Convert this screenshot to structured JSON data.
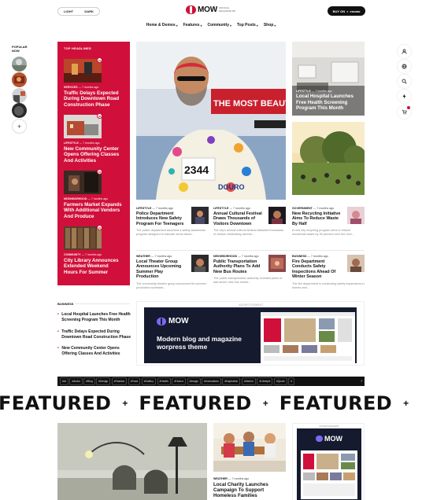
{
  "theme_toggle": {
    "light": "LIGHT",
    "dark": "DARK"
  },
  "brand": {
    "name": "MOW",
    "tagline": "OFFICIAL MAGAZINE WP"
  },
  "buy_button": {
    "prefix": "BUY ON",
    "market": "envato"
  },
  "nav": [
    {
      "label": "Home & Demos"
    },
    {
      "label": "Features"
    },
    {
      "label": "Community"
    },
    {
      "label": "Top Posts"
    },
    {
      "label": "Shop"
    }
  ],
  "popular": {
    "label": "POPULAR NOW",
    "add": "+"
  },
  "right_rail": [
    "user-icon",
    "globe-icon",
    "search-icon",
    "bolt-icon",
    "cart-icon"
  ],
  "top_headlines": {
    "title": "TOP HEADLINES",
    "items": [
      {
        "badge": "01",
        "category": "SERVICES",
        "time": "7 months ago",
        "title": "Traffic Delays Expected During Downtown Road Construction Phase"
      },
      {
        "badge": "02",
        "category": "LIFESTYLE",
        "time": "7 months ago",
        "title": "New Community Center Opens Offering Classes And Activities"
      },
      {
        "badge": "03",
        "category": "NEIGHBORHOOD",
        "time": "7 months ago",
        "title": "Farmers Market Expands With Additional Vendors And Produce"
      },
      {
        "badge": "04",
        "category": "COMMUNITY",
        "time": "7 months ago",
        "title": "City Library Announces Extended Weekend Hours For Summer"
      }
    ]
  },
  "hero": {
    "bib_number": "2344",
    "banner": "THE MOST BEAUTIFUL",
    "runner_label": "DOURO"
  },
  "side_card": {
    "category": "LIFESTYLE",
    "time": "7 months ago",
    "title": "Local Hospital Launches Free Health Screening Program This Month"
  },
  "articles": [
    {
      "category": "LIFESTYLE",
      "time": "7 months ago",
      "title": "Police Department Introduces New Safety Program For Teenagers",
      "excerpt": "The police department launched a safety awareness program designed to educate teens about..."
    },
    {
      "category": "LIFESTYLE",
      "time": "7 months ago",
      "title": "Annual Cultural Festival Draws Thousands of Visitors Downtown",
      "excerpt": "The city's annual cultural festival attracted thousands of visitors celebrating diverse..."
    },
    {
      "category": "GOVERNMENT",
      "time": "7 months ago",
      "title": "New Recycling Initiative Aims To Reduce Waste By Half",
      "excerpt": "A new city recycling program aims to reduce household waste by 50 percent over the next..."
    },
    {
      "category": "WEATHER",
      "time": "7 months ago",
      "title": "Local Theater Group Announces Upcoming Summer Play Production",
      "excerpt": "The community theater group announced its summer production schedule..."
    },
    {
      "category": "NEIGHBORHOOD",
      "time": "7 months ago",
      "title": "Public Transportation Authority Plans To Add New Bus Routes",
      "excerpt": "The public transportation authority revealed plans to add seven new bus routes..."
    },
    {
      "category": "BUSINESS",
      "time": "7 months ago",
      "title": "Fire Department Conducts Safety Inspections Ahead Of Winter Season",
      "excerpt": "The fire department is conducting safety inspections in homes and..."
    }
  ],
  "business": {
    "label": "BUSINESS",
    "items": [
      "Local Hospital Launches Free Health Screening Program This Month",
      "Traffic Delays Expected During Downtown Road Construction Phase",
      "New Community Center Opens Offering Classes And Activities"
    ]
  },
  "advertisement": {
    "label": "ADVERTISEMENT",
    "logo": "MOW",
    "copy": "Modern blog and magazine worpress theme"
  },
  "tags": [
    "#AI",
    "#Audio",
    "#Blog",
    "#Design",
    "#Fashion",
    "#Food",
    "#Gallery",
    "#Health",
    "#Humor",
    "#Image",
    "#Innovations",
    "#Inspiration",
    "#Interior",
    "#Lifestyle",
    "#Quote",
    "#"
  ],
  "tags_next": "›",
  "featured": {
    "word": "FEATURED",
    "separator": "+"
  },
  "bottom_article": {
    "category": "WEATHER",
    "time": "7 months ago",
    "title": "Local Charity Launches Campaign To Support Homeless Families"
  },
  "bottom_ad": {
    "label": "ADVERTISEMENT",
    "logo": "MOW"
  },
  "colors": {
    "accent": "#d0103a",
    "dark": "#111111",
    "ad_bg": "#151a2e",
    "ad_mark": "#7d68f5"
  }
}
